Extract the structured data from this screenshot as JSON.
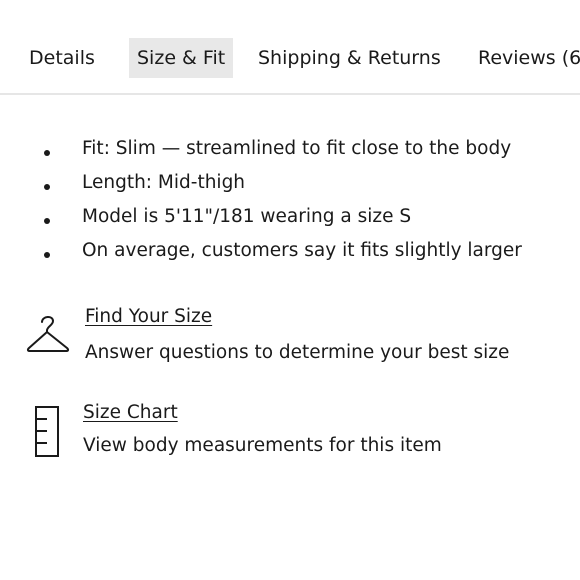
{
  "tabs": [
    {
      "label": "Details",
      "active": false
    },
    {
      "label": "Size & Fit",
      "active": true
    },
    {
      "label": "Shipping & Returns",
      "active": false
    },
    {
      "label": "Reviews (6"
    }
  ],
  "fit_details": [
    "Fit: Slim — streamlined to fit close to the body",
    "Length: Mid-thigh",
    "Model is 5'11\"/181 wearing a size S",
    "On average, customers say it fits slightly larger"
  ],
  "find_your_size": {
    "icon": "hanger-icon",
    "title": "Find Your Size",
    "description": "Answer questions to determine your best size"
  },
  "size_chart": {
    "icon": "ruler-icon",
    "title": "Size Chart",
    "description": "View body measurements for this item"
  }
}
